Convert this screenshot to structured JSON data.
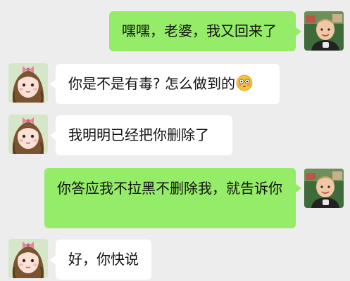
{
  "messages": [
    {
      "sender": "me",
      "text": "嘿嘿，老婆，我又回来了"
    },
    {
      "sender": "them",
      "text": "你是不是有毒? 怎么做到的",
      "emoji": "flushed-face-icon"
    },
    {
      "sender": "them",
      "text": "我明明已经把你删除了"
    },
    {
      "sender": "me",
      "text": "你答应我不拉黑不删除我，就告诉你"
    },
    {
      "sender": "them",
      "text": "好，你快说"
    }
  ],
  "colors": {
    "background": "#ededed",
    "my_bubble": "#95ec69",
    "their_bubble": "#ffffff"
  }
}
